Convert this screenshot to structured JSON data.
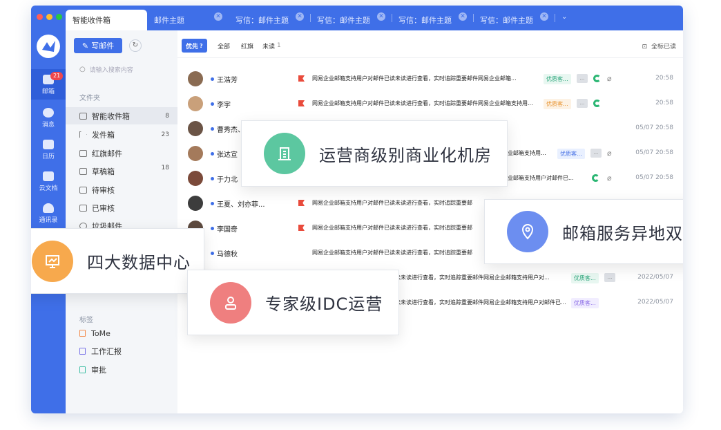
{
  "tabs": {
    "active": "智能收件箱",
    "items": [
      "邮件主题",
      "写信：邮件主题",
      "写信：邮件主题",
      "写信：邮件主题",
      "写信：邮件主题"
    ]
  },
  "rail": [
    {
      "label": "邮箱",
      "badge": "21"
    },
    {
      "label": "消息"
    },
    {
      "label": "日历"
    },
    {
      "label": "云文档"
    },
    {
      "label": "通讯录"
    }
  ],
  "sidebar": {
    "compose": "写邮件",
    "search_placeholder": "请输入搜索内容",
    "folders_title": "文件夹",
    "folders": [
      {
        "label": "智能收件箱",
        "count": "8"
      },
      {
        "label": "发件箱",
        "count": "23"
      },
      {
        "label": "红旗邮件",
        "count": ""
      },
      {
        "label": "草稿箱",
        "count": "18"
      },
      {
        "label": "待审核",
        "count": ""
      },
      {
        "label": "已审核",
        "count": ""
      },
      {
        "label": "垃圾邮件",
        "count": ""
      }
    ],
    "tags_title": "标签",
    "tags": [
      {
        "label": "ToMe",
        "color": "#f28b4b"
      },
      {
        "label": "工作汇报",
        "color": "#7a74e8"
      },
      {
        "label": "审批",
        "color": "#3fbfa4"
      }
    ]
  },
  "filters": {
    "priority": "优先",
    "all": "全部",
    "flagged": "红旗",
    "unread": "未读",
    "unread_count": "1",
    "mark_all": "全标已读"
  },
  "emails": [
    {
      "sender": "王浩芳",
      "flag": true,
      "subject": "网易企业邮箱支持用户对邮件已读未读进行查看，实时追踪重要邮件网易企业邮箱...",
      "label": "优质客...",
      "label_color": "green",
      "grey": true,
      "green": true,
      "clip": true,
      "time": "20:58"
    },
    {
      "sender": "李宇",
      "flag": true,
      "subject": "网易企业邮箱支持用户对邮件已读未读进行查看，实时追踪重要邮件网易企业邮箱支持用...",
      "label": "优质客...",
      "label_color": "orange",
      "grey": true,
      "green": true,
      "clip": false,
      "time": "20:58"
    },
    {
      "sender": "曹秀杰、",
      "flag": false,
      "subject": "",
      "label": "",
      "grey": false,
      "green": false,
      "clip": false,
      "time": "05/07 20:58"
    },
    {
      "sender": "张达宣",
      "flag": false,
      "subject": "企业邮箱支持用...",
      "label": "优质客...",
      "label_color": "blue",
      "grey": true,
      "green": false,
      "clip": true,
      "time": "05/07 20:58"
    },
    {
      "sender": "于力北",
      "flag": false,
      "subject": "企业邮箱支持用户对邮件已...",
      "label": "",
      "grey": false,
      "green": true,
      "clip": true,
      "time": "05/07 20:58"
    },
    {
      "sender": "王夏、刘亦菲...",
      "flag": true,
      "subject": "网易企业邮箱支持用户对邮件已读未读进行查看，实时追踪重要邮",
      "label": "",
      "grey": false,
      "green": false,
      "clip": false,
      "time": ""
    },
    {
      "sender": "李国奇",
      "flag": true,
      "subject": "网易企业邮箱支持用户对邮件已读未读进行查看，实时追踪重要邮",
      "label": "",
      "grey": false,
      "green": false,
      "clip": false,
      "time": ""
    },
    {
      "sender": "马德秋",
      "flag": false,
      "subject": "网易企业邮箱支持用户对邮件已读未读进行查看，实时追踪重要邮",
      "label": "",
      "grey": false,
      "green": false,
      "clip": false,
      "time": ""
    },
    {
      "sender": "",
      "flag": false,
      "subject": "读未读进行查看，实时追踪重要邮件网易企业邮箱支持用户对...",
      "label": "优质客...",
      "label_color": "green",
      "grey": true,
      "green": false,
      "clip": false,
      "time": "2022/05/07"
    },
    {
      "sender": "",
      "flag": false,
      "subject": "读未读进行查看，实时追踪重要邮件网易企业邮箱支持用户对邮件已...",
      "label": "优质客...",
      "label_color": "purple",
      "grey": false,
      "green": false,
      "clip": false,
      "time": "2022/05/07"
    }
  ],
  "features": [
    {
      "text": "运营商级别商业化机房",
      "color": "#5cc7a0",
      "icon": "building-icon"
    },
    {
      "text": "邮箱服务异地双活",
      "color": "#6c8ef0",
      "icon": "location-pin-icon"
    },
    {
      "text": "四大数据中心",
      "color": "#f7a94d",
      "icon": "monitor-chart-icon"
    },
    {
      "text": "专家级IDC运营",
      "color": "#ef7f7f",
      "icon": "person-icon"
    }
  ]
}
